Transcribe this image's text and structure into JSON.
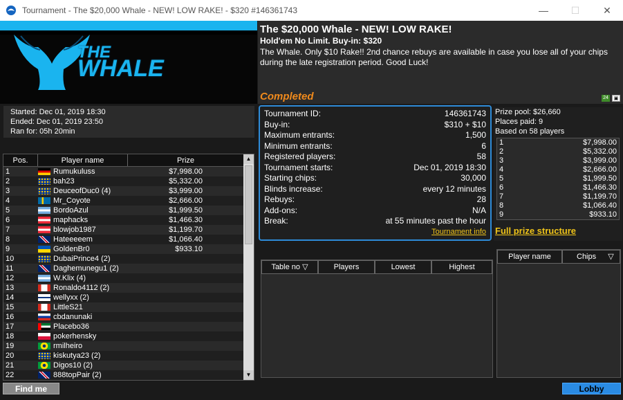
{
  "window": {
    "title": "Tournament - The $20,000 Whale - NEW! LOW RAKE! - $320 #146361743",
    "minimize": "—",
    "maximize": "☐",
    "close": "✕"
  },
  "logo": {
    "line1": "THE",
    "line2": "WHALE",
    "brand_color": "#1ab4ef"
  },
  "description": {
    "title": "The $20,000 Whale - NEW! LOW RAKE!",
    "subtitle": "Hold'em No Limit. Buy-in: $320",
    "text": "The Whale. Only $10 Rake!! 2nd chance rebuys are available in case you lose all of your chips during the late registration period. Good Luck!"
  },
  "status": {
    "label": "Completed",
    "color": "#f08a1c",
    "icon1": "24",
    "icon2": "▣"
  },
  "dates": {
    "started": "Started: Dec 01, 2019 18:30",
    "ended": "Ended: Dec 01, 2019 23:50",
    "ran_for": "Ran for: 05h 20min"
  },
  "results": {
    "headers": {
      "pos": "Pos.",
      "name": "Player name",
      "prize": "Prize"
    },
    "rows": [
      {
        "pos": "1",
        "name": "Rumukuluss",
        "prize": "$7,998.00",
        "flag": "de"
      },
      {
        "pos": "2",
        "name": "bah23",
        "prize": "$5,332.00",
        "flag": "eu"
      },
      {
        "pos": "3",
        "name": "DeuceofDuc0 (4)",
        "prize": "$3,999.00",
        "flag": "eu"
      },
      {
        "pos": "4",
        "name": "Mr_Coyote",
        "prize": "$2,666.00",
        "flag": "se"
      },
      {
        "pos": "5",
        "name": "BordoAzul",
        "prize": "$1,999.50",
        "flag": "ar"
      },
      {
        "pos": "6",
        "name": "maphacks",
        "prize": "$1,466.30",
        "flag": "at"
      },
      {
        "pos": "7",
        "name": "blowjob1987",
        "prize": "$1,199.70",
        "flag": "at"
      },
      {
        "pos": "8",
        "name": "Hateeeeem",
        "prize": "$1,066.40",
        "flag": "gb"
      },
      {
        "pos": "9",
        "name": "GoldenBr0",
        "prize": "$933.10",
        "flag": "ua"
      },
      {
        "pos": "10",
        "name": "DubaiPrince4 (2)",
        "prize": "",
        "flag": "eu"
      },
      {
        "pos": "11",
        "name": "Daghemunegu1 (2)",
        "prize": "",
        "flag": "gb"
      },
      {
        "pos": "12",
        "name": "W.Klix (4)",
        "prize": "",
        "flag": "ar"
      },
      {
        "pos": "13",
        "name": "Ronaldo4112 (2)",
        "prize": "",
        "flag": "ca"
      },
      {
        "pos": "14",
        "name": "wellyxx (2)",
        "prize": "",
        "flag": "fi"
      },
      {
        "pos": "15",
        "name": "LittleS21",
        "prize": "",
        "flag": "ca"
      },
      {
        "pos": "16",
        "name": "cbdanunaki",
        "prize": "",
        "flag": "ru"
      },
      {
        "pos": "17",
        "name": "Placebo36",
        "prize": "",
        "flag": "ae"
      },
      {
        "pos": "18",
        "name": "pokerhensky",
        "prize": "",
        "flag": "pl"
      },
      {
        "pos": "19",
        "name": "rmilheiro",
        "prize": "",
        "flag": "br"
      },
      {
        "pos": "20",
        "name": "kiskutya23 (2)",
        "prize": "",
        "flag": "eu"
      },
      {
        "pos": "21",
        "name": "Digos10 (2)",
        "prize": "",
        "flag": "br"
      },
      {
        "pos": "22",
        "name": "888topPair (2)",
        "prize": "",
        "flag": "gb"
      }
    ]
  },
  "info": {
    "rows": [
      {
        "label": "Tournament ID:",
        "value": "146361743"
      },
      {
        "label": "Buy-in:",
        "value": "$310 + $10"
      },
      {
        "label": "Maximum entrants:",
        "value": "1,500"
      },
      {
        "label": "Minimum entrants:",
        "value": "6"
      },
      {
        "label": "Registered players:",
        "value": "58"
      },
      {
        "label": "Tournament starts:",
        "value": "Dec 01, 2019 18:30"
      },
      {
        "label": "Starting chips:",
        "value": "30,000"
      },
      {
        "label": "Blinds increase:",
        "value": "every 12 minutes"
      },
      {
        "label": "Rebuys:",
        "value": "28"
      },
      {
        "label": "Add-ons:",
        "value": "N/A"
      },
      {
        "label": "Break:",
        "value": "at 55 minutes past the hour"
      }
    ],
    "link": "Tournament info",
    "border_color": "#2e8bd8"
  },
  "prizes": {
    "pool": "Prize pool: $26,660",
    "paid": "Places paid: 9",
    "based": "Based on 58 players",
    "rows": [
      {
        "place": "1",
        "amount": "$7,998.00"
      },
      {
        "place": "2",
        "amount": "$5,332.00"
      },
      {
        "place": "3",
        "amount": "$3,999.00"
      },
      {
        "place": "4",
        "amount": "$2,666.00"
      },
      {
        "place": "5",
        "amount": "$1,999.50"
      },
      {
        "place": "6",
        "amount": "$1,466.30"
      },
      {
        "place": "7",
        "amount": "$1,199.70"
      },
      {
        "place": "8",
        "amount": "$1,066.40"
      },
      {
        "place": "9",
        "amount": "$933.10"
      }
    ],
    "full_link": "Full prize structure"
  },
  "tables": {
    "headers": {
      "table_no": "Table no",
      "players": "Players",
      "lowest": "Lowest",
      "highest": "Highest"
    }
  },
  "players": {
    "headers": {
      "name": "Player name",
      "chips": "Chips"
    }
  },
  "buttons": {
    "find_me": "Find me",
    "lobby": "Lobby"
  }
}
